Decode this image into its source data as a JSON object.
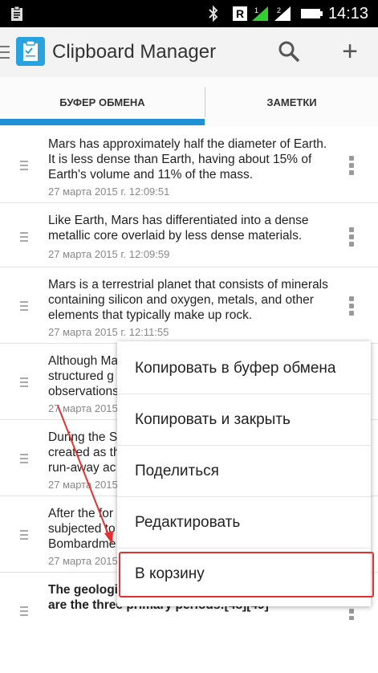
{
  "status_bar": {
    "time": "14:13",
    "icons": [
      "clipboard-notification-icon",
      "bluetooth-icon",
      "roaming-icon",
      "signal-1-icon",
      "signal-2-icon",
      "battery-icon"
    ]
  },
  "app_bar": {
    "title": "Clipboard Manager",
    "icons": [
      "menu-icon",
      "clipboard-app-icon",
      "search-icon",
      "add-icon"
    ]
  },
  "tabs": [
    {
      "label": "БУФЕР ОБМЕНА",
      "active": true
    },
    {
      "label": "ЗАМЕТКИ",
      "active": false
    }
  ],
  "clips": [
    {
      "text": "Mars has approximately half the diameter of Earth. It is less dense than Earth, having about 15% of Earth's volume and 11% of the mass.",
      "date": "27 марта 2015 г. 12:09:51"
    },
    {
      "text": "Like Earth, Mars has differentiated into a dense metallic core overlaid by less dense materials.",
      "date": "27 марта 2015 г. 12:09:59"
    },
    {
      "text": "Mars is a terrestrial planet that consists of minerals containing silicon and oxygen, metals, and other elements that typically make up rock.",
      "date": "27 марта 2015 г. 12:11:55"
    },
    {
      "text": "Although Ma structured g observations",
      "date": "27 марта 2015"
    },
    {
      "text": "During the S created as th run-away ac",
      "date": "27 марта 2015"
    },
    {
      "text": "After the for subjected to Bombardme",
      "date": "27 марта 2015"
    },
    {
      "text": "The geologic many periods, but the following are the three primary periods:[48][49]",
      "date": ""
    }
  ],
  "context_menu": {
    "items": [
      "Копировать в буфер обмена",
      "Копировать и закрыть",
      "Поделиться",
      "Редактировать",
      "В корзину"
    ],
    "highlighted_index": 4,
    "highlight_color": "#e53030"
  },
  "accent_color": "#1e91d6"
}
